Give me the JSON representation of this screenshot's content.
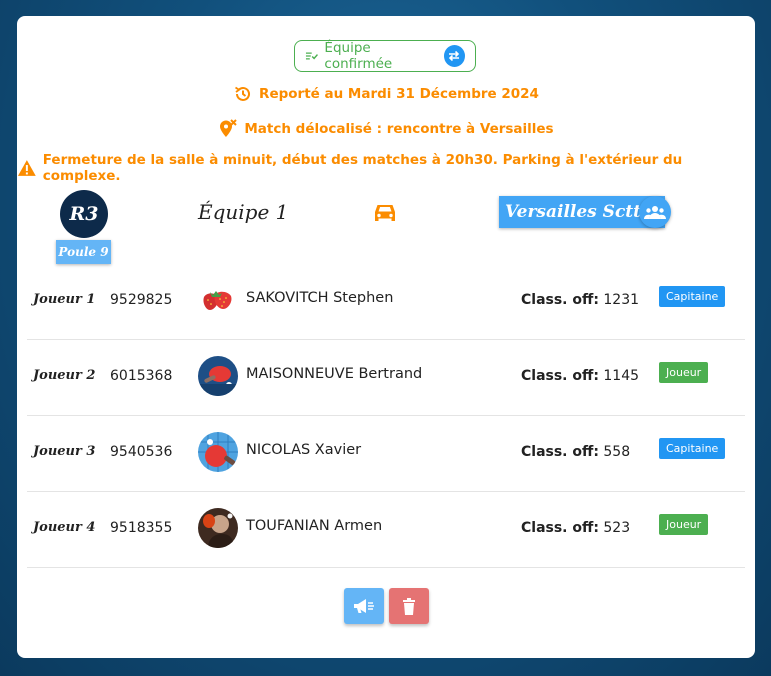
{
  "status": {
    "team_confirmed": "Équipe confirmée",
    "postponed": "Reporté au Mardi 31 Décembre 2024",
    "relocated": "Match délocalisé : rencontre à Versailles",
    "notice": "Fermeture de la salle à minuit, début des matches à 20h30. Parking à l'extérieur du complexe."
  },
  "match": {
    "division": "R3",
    "pool": "Poule 9",
    "home_team": "Équipe 1",
    "away_team": "Versailles Sctt 3"
  },
  "players": [
    {
      "slot": "Joueur 1",
      "license": "9529825",
      "name": "SAKOVITCH Stephen",
      "class_label": "Class. off:",
      "class_value": "1231",
      "role": "Capitaine",
      "avatar_icon": "strawberry-icon"
    },
    {
      "slot": "Joueur 2",
      "license": "6015368",
      "name": "MAISONNEUVE Bertrand",
      "class_label": "Class. off:",
      "class_value": "1145",
      "role": "Joueur",
      "avatar_icon": "ping-pong-icon"
    },
    {
      "slot": "Joueur 3",
      "license": "9540536",
      "name": "NICOLAS Xavier",
      "class_label": "Class. off:",
      "class_value": "558",
      "role": "Capitaine",
      "avatar_icon": "ping-pong-icon"
    },
    {
      "slot": "Joueur 4",
      "license": "9518355",
      "name": "TOUFANIAN Armen",
      "class_label": "Class. off:",
      "class_value": "523",
      "role": "Joueur",
      "avatar_icon": "ping-pong-player-icon"
    }
  ],
  "colors": {
    "confirmed": "#4caf50",
    "warning": "#fb8c00",
    "captain": "#2196f3",
    "player": "#4caf50",
    "announce_button": "#64b5f6",
    "delete_button": "#e57373"
  }
}
